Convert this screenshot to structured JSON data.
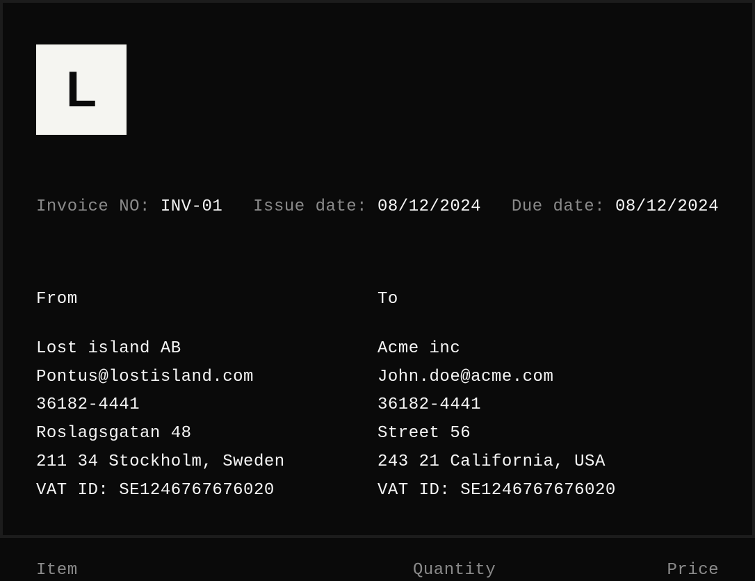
{
  "logo": {
    "letter": "L"
  },
  "meta": {
    "invoice_no_label": "Invoice NO:",
    "invoice_no": "INV-01",
    "issue_date_label": "Issue date:",
    "issue_date": "08/12/2024",
    "due_date_label": "Due date:",
    "due_date": "08/12/2024"
  },
  "from": {
    "heading": "From",
    "name": "Lost island AB",
    "email": "Pontus@lostisland.com",
    "phone": "36182-4441",
    "street": "Roslagsgatan 48",
    "city": "211 34 Stockholm, Sweden",
    "vat": "VAT ID: SE1246767676020"
  },
  "to": {
    "heading": "To",
    "name": "Acme inc",
    "email": "John.doe@acme.com",
    "phone": "36182-4441",
    "street": "Street 56",
    "city": "243 21 California, USA",
    "vat": "VAT ID: SE1246767676020"
  },
  "table": {
    "item_header": "Item",
    "quantity_header": "Quantity",
    "price_header": "Price"
  }
}
